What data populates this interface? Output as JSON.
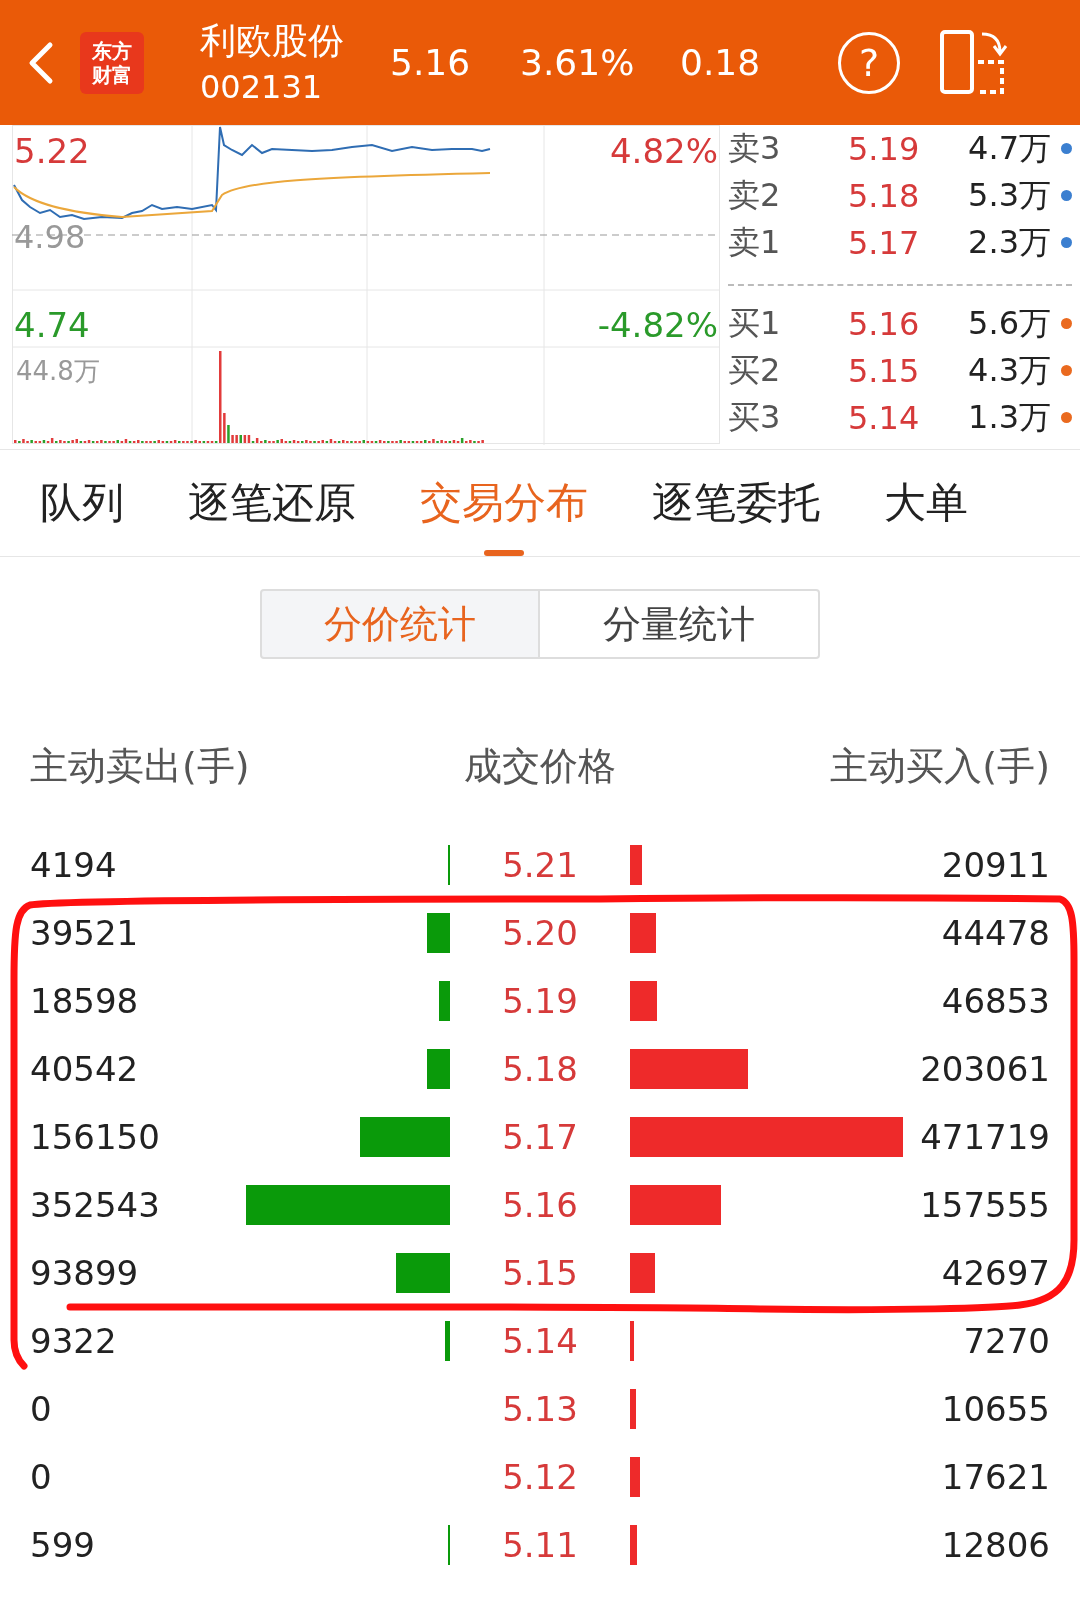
{
  "header": {
    "logo_lines": [
      "东方",
      "财富"
    ],
    "name": "利欧股份",
    "code": "002131",
    "price": "5.16",
    "change_pct": "3.61%",
    "change": "0.18",
    "help": "?"
  },
  "chart": {
    "high": "5.22",
    "high_pct": "4.82%",
    "mid": "4.98",
    "low": "4.74",
    "low_pct": "-4.82%",
    "volume_max": "44.8万"
  },
  "asks": [
    {
      "label": "卖3",
      "price": "5.19",
      "volume": "4.7万",
      "color": "#3b7fd0"
    },
    {
      "label": "卖2",
      "price": "5.18",
      "volume": "5.3万",
      "color": "#3b7fd0"
    },
    {
      "label": "卖1",
      "price": "5.17",
      "volume": "2.3万",
      "color": "#3b7fd0"
    }
  ],
  "bids": [
    {
      "label": "买1",
      "price": "5.16",
      "volume": "5.6万",
      "color": "#ea6a1f"
    },
    {
      "label": "买2",
      "price": "5.15",
      "volume": "4.3万",
      "color": "#ea6a1f"
    },
    {
      "label": "买3",
      "price": "5.14",
      "volume": "1.3万",
      "color": "#ea6a1f"
    }
  ],
  "tabs": [
    {
      "label": "队列",
      "selected": false
    },
    {
      "label": "逐笔还原",
      "selected": false
    },
    {
      "label": "交易分布",
      "selected": true
    },
    {
      "label": "逐笔委托",
      "selected": false
    },
    {
      "label": "大单",
      "selected": false
    }
  ],
  "segments": [
    {
      "label": "分价统计",
      "selected": true
    },
    {
      "label": "分量统计",
      "selected": false
    }
  ],
  "table": {
    "columns": [
      "主动卖出(手)",
      "成交价格",
      "主动买入(手)"
    ],
    "rows": [
      {
        "sell": "4194",
        "price": "5.21",
        "buy": "20911"
      },
      {
        "sell": "39521",
        "price": "5.20",
        "buy": "44478"
      },
      {
        "sell": "18598",
        "price": "5.19",
        "buy": "46853"
      },
      {
        "sell": "40542",
        "price": "5.18",
        "buy": "203061"
      },
      {
        "sell": "156150",
        "price": "5.17",
        "buy": "471719"
      },
      {
        "sell": "352543",
        "price": "5.16",
        "buy": "157555"
      },
      {
        "sell": "93899",
        "price": "5.15",
        "buy": "42697"
      },
      {
        "sell": "9322",
        "price": "5.14",
        "buy": "7270"
      },
      {
        "sell": "0",
        "price": "5.13",
        "buy": "10655"
      },
      {
        "sell": "0",
        "price": "5.12",
        "buy": "17621"
      },
      {
        "sell": "599",
        "price": "5.11",
        "buy": "12806"
      }
    ]
  }
}
